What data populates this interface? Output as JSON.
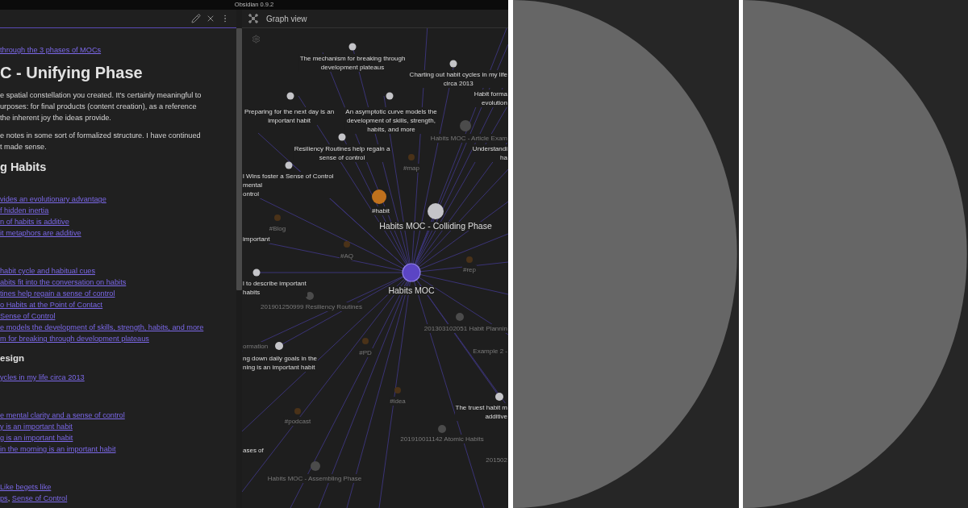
{
  "app_title": "Obsidian 0.9.2",
  "editor": {
    "blocks": [
      {
        "kind": "links",
        "items": [
          {
            "text": "through the 3 phases of MOCs"
          }
        ]
      },
      {
        "kind": "heading1",
        "text": "C - Unifying Phase"
      },
      {
        "kind": "paragraph",
        "lines": [
          "e spatial constellation you created. It's certainly meaningful to",
          "urposes: for final products (content creation), as a reference",
          "the inherent joy the ideas provide."
        ]
      },
      {
        "kind": "paragraph",
        "lines": [
          "e notes in some sort of formalized structure. I have continued",
          "t made sense."
        ]
      },
      {
        "kind": "heading2",
        "text": "g Habits"
      },
      {
        "kind": "links",
        "items": [
          {
            "text": "vides an evolutionary advantage"
          },
          {
            "text": "f hidden inertia"
          },
          {
            "text": "n of habits is additive"
          },
          {
            "text": "it metaphors are additive"
          }
        ]
      },
      {
        "kind": "links",
        "items": [
          {
            "text": "habit cycle and habitual cues"
          },
          {
            "text": "abits fit into the conversation on habits"
          },
          {
            "text": "tines help regain a sense of control"
          },
          {
            "text": "o Habits at the Point of Contact"
          },
          {
            "text": "Sense of Control"
          },
          {
            "text": "e models the development of skills, strength, habits, and more"
          },
          {
            "text": "m for breaking through development plateaus"
          }
        ]
      },
      {
        "kind": "heading3",
        "text": "esign"
      },
      {
        "kind": "links",
        "items": [
          {
            "text": "ycles in my life circa 2013"
          }
        ]
      },
      {
        "kind": "links",
        "items": [
          {
            "text": "e mental clarity and a sense of control"
          },
          {
            "text": "y is an important habit"
          },
          {
            "text": "g is an important habit"
          },
          {
            "text": "in the morning is an important habit"
          }
        ]
      },
      {
        "kind": "links",
        "items": [
          {
            "text": "Like begets like"
          },
          {
            "parts": [
              {
                "text": "ps",
                "kind": "link"
              },
              {
                "text": ", ",
                "kind": "plain"
              },
              {
                "text": "Sense of Control",
                "kind": "link"
              }
            ]
          }
        ]
      }
    ]
  },
  "graph": {
    "title": "Graph view",
    "nodes": [
      {
        "kind": "note",
        "faded": false,
        "label": "The mechanism for breaking through\ndevelopment plateaus"
      },
      {
        "kind": "note",
        "faded": false,
        "label": "Charting out habit cycles in my life\ncirca 2013"
      },
      {
        "kind": "offscreen",
        "faded": false,
        "label": "Habit forma\nevolution"
      },
      {
        "kind": "note",
        "faded": false,
        "label": "Preparing for the next day is an\nimportant habit"
      },
      {
        "kind": "note",
        "faded": false,
        "label": "An asymptotic curve models the\ndevelopment of skills, strength,\nhabits, and more"
      },
      {
        "kind": "note",
        "faded": true,
        "label": "Habits MOC - Article Exam"
      },
      {
        "kind": "note",
        "faded": false,
        "label": "Resiliency Routines help regain a\nsense of control"
      },
      {
        "kind": "offscreen",
        "faded": false,
        "label": "Understandi\nha"
      },
      {
        "kind": "tag",
        "faded": true,
        "label": "#map"
      },
      {
        "kind": "note",
        "faded": false,
        "label": "l Wins foster a Sense of Control\nmental\nontrol"
      },
      {
        "kind": "tag",
        "faded": false,
        "label": "#habit"
      },
      {
        "kind": "tag",
        "faded": true,
        "label": "#Blog"
      },
      {
        "kind": "note",
        "faded": false,
        "label": "Habits MOC - Colliding Phase"
      },
      {
        "kind": "offscreen",
        "faded": false,
        "label": "important"
      },
      {
        "kind": "tag",
        "faded": true,
        "label": "#AQ"
      },
      {
        "kind": "tag",
        "faded": true,
        "label": "#rep"
      },
      {
        "kind": "note",
        "faded": false,
        "label": "l to describe important\nhabits"
      },
      {
        "kind": "current",
        "faded": false,
        "label": "Habits MOC"
      },
      {
        "kind": "note",
        "faded": true,
        "label": "201901250999 Resiliency Routines"
      },
      {
        "kind": "note",
        "faded": true,
        "label": "201303102051 Habit Plannin"
      },
      {
        "kind": "offscreen",
        "faded": true,
        "label": "ormation"
      },
      {
        "kind": "tag",
        "faded": true,
        "label": "#PD"
      },
      {
        "kind": "offscreen",
        "faded": true,
        "label": "Example 2 -"
      },
      {
        "kind": "note",
        "faded": false,
        "label": "ng down daily goals in the\nning is an important habit"
      },
      {
        "kind": "tag",
        "faded": true,
        "label": "#idea"
      },
      {
        "kind": "note",
        "faded": false,
        "label": "The truest habit m\nadditive"
      },
      {
        "kind": "tag",
        "faded": true,
        "label": "#podcast"
      },
      {
        "kind": "note",
        "faded": true,
        "label": "201910011142 Atomic Habits"
      },
      {
        "kind": "offscreen",
        "faded": false,
        "label": "ases of"
      },
      {
        "kind": "offscreen",
        "faded": true,
        "label": "201502"
      },
      {
        "kind": "note",
        "faded": true,
        "label": "Habits MOC - Assembling Phase"
      }
    ]
  },
  "decorations": [
    {
      "kind": "half-circle"
    },
    {
      "kind": "half-circle"
    }
  ]
}
